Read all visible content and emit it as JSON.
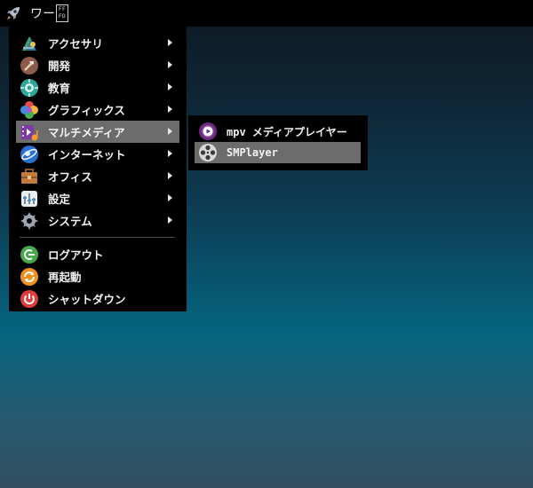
{
  "taskbar": {
    "launcher_icon": "rocket-icon",
    "task_label": "ワー",
    "task_glyph_top": "FF",
    "task_glyph_bottom": "FD"
  },
  "menu": {
    "items": [
      {
        "label": "アクセサリ",
        "icon": "accessories-icon",
        "submenu": true
      },
      {
        "label": "開発",
        "icon": "development-icon",
        "submenu": true
      },
      {
        "label": "教育",
        "icon": "education-icon",
        "submenu": true
      },
      {
        "label": "グラフィックス",
        "icon": "graphics-icon",
        "submenu": true
      },
      {
        "label": "マルチメディア",
        "icon": "multimedia-icon",
        "submenu": true,
        "active": true
      },
      {
        "label": "インターネット",
        "icon": "internet-icon",
        "submenu": true
      },
      {
        "label": "オフィス",
        "icon": "office-icon",
        "submenu": true
      },
      {
        "label": "設定",
        "icon": "settings-icon",
        "submenu": true
      },
      {
        "label": "システム",
        "icon": "system-icon",
        "submenu": true
      }
    ],
    "session_items": [
      {
        "label": "ログアウト",
        "icon": "logout-icon"
      },
      {
        "label": "再起動",
        "icon": "reboot-icon"
      },
      {
        "label": "シャットダウン",
        "icon": "shutdown-icon"
      }
    ]
  },
  "submenu": {
    "items": [
      {
        "label": "mpv メディアプレイヤー",
        "icon": "mpv-icon"
      },
      {
        "label": "SMPlayer",
        "icon": "smplayer-icon",
        "active": true
      }
    ]
  },
  "colors": {
    "menu_bg": "#000000",
    "highlight": "#6c6c6c",
    "text": "#f2f2f2"
  }
}
